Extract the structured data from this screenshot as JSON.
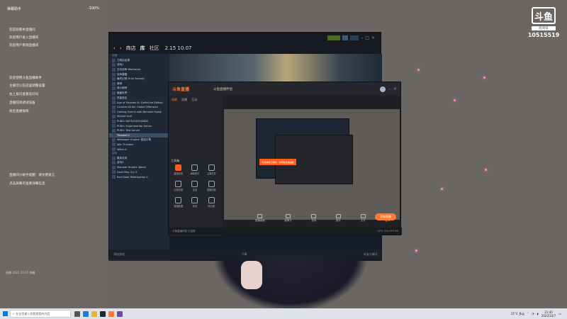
{
  "chat": {
    "header_left": "弹幕助手",
    "header_right": "-100%",
    "lines_group1": [
      "欢迎观看本直播间",
      "欢迎用户进入直播间",
      "欢迎用户来到直播间"
    ],
    "lines_group2": [
      "欢迎使用斗鱼直播助手",
      "主播可以在这里调整设置",
      "右上角可查看房间号",
      "直播前请调试设备",
      "祝您直播愉快"
    ],
    "lines_group3": [
      "直播间小助手提醒：请文明发言",
      "点击屏幕可查看详细信息"
    ],
    "footer": "直播 2022.10.07 弹幕"
  },
  "logo": {
    "mark": "斗鱼",
    "sub": "房间号",
    "room_id": "10515519"
  },
  "steam": {
    "nav": [
      "商店",
      "库",
      "社区"
    ],
    "version": "2.15 10.07",
    "sections": [
      "收藏",
      "游戏"
    ],
    "games": [
      "刀塔自走棋",
      "游戏1",
      "无尽战争 Warframe",
      "战争雷霆",
      "最终幻想 Final Fantasy",
      "原神",
      "骑士精神",
      "魔兽世界",
      "质量效应",
      "Age of Empires III: Definitive Edition",
      "Counter-Strike: Global Offensive",
      "Getting Over It with Bennett Foddy",
      "MyGolf Golf",
      "PUBG: BATTLEGROUNDS",
      "PUBG: Experimental Server",
      "PUBG: Test Server",
      "Titanfall 2",
      "Wallpaper Engine: 壁纸引擎",
      "War Thunder",
      "Witch It",
      "模拟农场",
      "游戏2",
      "Monster Hunter: World",
      "Devil May Cry 5",
      "Red Dead Redemption 2"
    ],
    "bottom_left": "添加游戏",
    "bottom_center": "下载",
    "bottom_right": "好友与聊天"
  },
  "douyu_app": {
    "brand": "斗鱼直播",
    "title": "斗鱼直播伴侣",
    "tabs": [
      "场景",
      "直播",
      "互动"
    ],
    "toolbox_label": "工具箱",
    "tools": [
      "直播设置",
      "弹幕助手",
      "主播任务",
      "礼物设置",
      "连麦",
      "直播回放",
      "直播数据",
      "音效",
      "粉丝团",
      "更多"
    ],
    "controls": [
      "直播画面",
      "摄像头",
      "游戏",
      "图片",
      "文字",
      "窗口"
    ],
    "toast": "已选择窗口捕获，请调整直播画面",
    "live_button": "开始直播",
    "status_left": "斗鱼直播伴侣 已连接",
    "status_right": "CPU 12%  FPS 60"
  },
  "taskbar": {
    "search_placeholder": "在这里输入你要搜索的内容",
    "weather": "21°C 多云",
    "time": "21:40",
    "date": "2022/10/7"
  }
}
